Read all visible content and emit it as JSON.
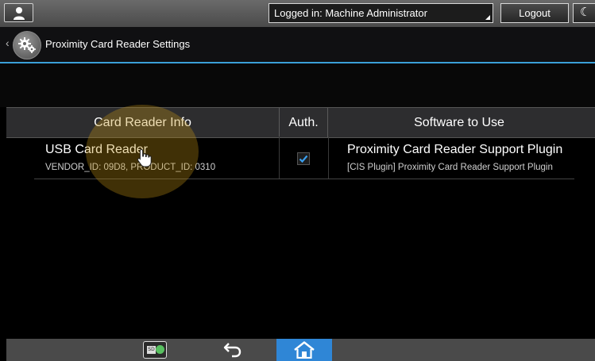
{
  "status_bar": {
    "login_text": "Logged in: Machine Administrator",
    "logout_label": "Logout",
    "moon_glyph": "☾",
    "user_icon": "user-icon",
    "accent": "#3aa0d8"
  },
  "title_bar": {
    "title": "Proximity Card Reader Settings",
    "icon": "gear-icon"
  },
  "table": {
    "headers": {
      "info": "Card Reader Info",
      "auth": "Auth.",
      "software": "Software to Use"
    },
    "rows": [
      {
        "name": "USB Card Reader",
        "ids": "VENDOR_ID: 09D8, PRODUCT_ID: 0310",
        "auth_checked": true,
        "software": "Proximity Card Reader Support Plugin",
        "software_sub": "[CIS Plugin] Proximity Card Reader Support Plugin"
      }
    ]
  },
  "bottom_bar": {
    "sd_label": "SD",
    "home_color": "#2f86d6"
  }
}
